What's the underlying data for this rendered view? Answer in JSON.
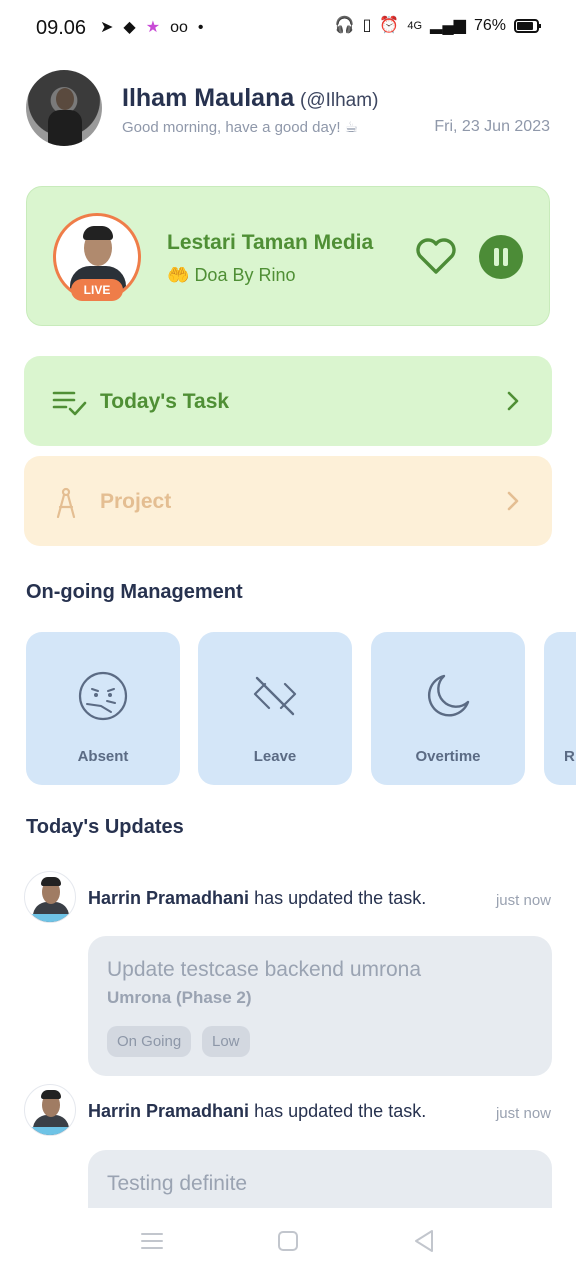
{
  "status_bar": {
    "time": "09.06",
    "battery": "76%",
    "network": "4G"
  },
  "header": {
    "name": "Ilham Maulana",
    "handle": "(@Ilham)",
    "greeting": "Good morning, have a good day! ☕",
    "date": "Fri, 23 Jun 2023"
  },
  "live": {
    "title": "Lestari Taman Media",
    "subtitle": "Doa By Rino",
    "badge": "LIVE",
    "accent": "#4f8f35",
    "badge_color": "#ef7d49",
    "icons": [
      "heart-icon",
      "pause-icon"
    ]
  },
  "nav": {
    "task_label": "Today's Task",
    "project_label": "Project"
  },
  "management": {
    "title": "On-going Management",
    "tiles": [
      {
        "label": "Absent",
        "icon": "sick-face-icon"
      },
      {
        "label": "Leave",
        "icon": "leave-icon"
      },
      {
        "label": "Overtime",
        "icon": "moon-icon"
      },
      {
        "label": "R",
        "icon": ""
      }
    ]
  },
  "updates": {
    "title": "Today's Updates",
    "items": [
      {
        "user": "Harrin Pramadhani",
        "action": "has updated the task.",
        "time": "just now",
        "task": "Update testcase backend umrona",
        "project": "Umrona (Phase 2)",
        "status": "On Going",
        "priority": "Low"
      },
      {
        "user": "Harrin Pramadhani",
        "action": "has updated the task.",
        "time": "just now",
        "task": "Testing definite",
        "project": "",
        "status": "",
        "priority": ""
      }
    ]
  }
}
